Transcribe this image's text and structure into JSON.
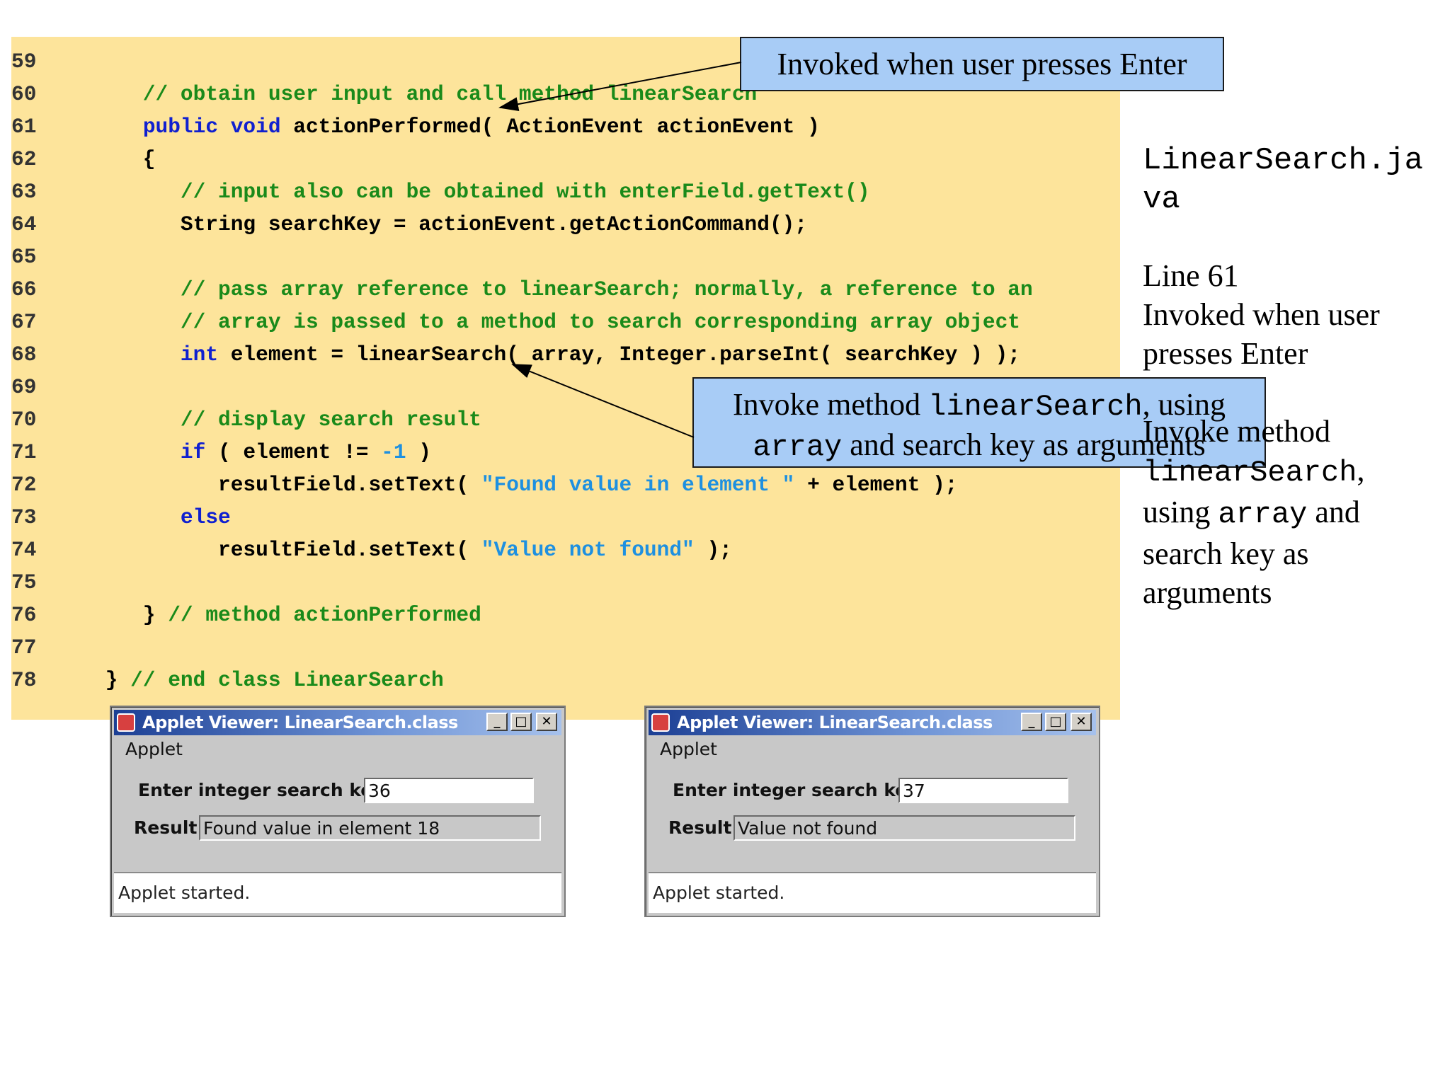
{
  "code": {
    "lines": [
      {
        "num": "59",
        "tokens": []
      },
      {
        "num": "60",
        "tokens": [
          {
            "t": "    // obtain user input and call method linearSearch",
            "c": "cm"
          }
        ]
      },
      {
        "num": "61",
        "tokens": [
          {
            "t": "    ",
            "c": "tx"
          },
          {
            "t": "public",
            "c": "kw"
          },
          {
            "t": " ",
            "c": "tx"
          },
          {
            "t": "void",
            "c": "kw"
          },
          {
            "t": " actionPerformed( ActionEvent actionEvent )",
            "c": "tx"
          }
        ]
      },
      {
        "num": "62",
        "tokens": [
          {
            "t": "    {",
            "c": "tx"
          }
        ]
      },
      {
        "num": "63",
        "tokens": [
          {
            "t": "       // input also can be obtained with enterField.getText()",
            "c": "cm"
          }
        ]
      },
      {
        "num": "64",
        "tokens": [
          {
            "t": "       String searchKey = actionEvent.getActionCommand();",
            "c": "tx"
          }
        ]
      },
      {
        "num": "65",
        "tokens": []
      },
      {
        "num": "66",
        "tokens": [
          {
            "t": "       // pass array reference to linearSearch; normally, a reference to an",
            "c": "cm"
          }
        ]
      },
      {
        "num": "67",
        "tokens": [
          {
            "t": "       // array is passed to a method to search corresponding array object",
            "c": "cm"
          }
        ]
      },
      {
        "num": "68",
        "tokens": [
          {
            "t": "       ",
            "c": "tx"
          },
          {
            "t": "int",
            "c": "kw"
          },
          {
            "t": " element = linearSearch( array, Integer.parseInt( searchKey ) );",
            "c": "tx"
          }
        ]
      },
      {
        "num": "69",
        "tokens": []
      },
      {
        "num": "70",
        "tokens": [
          {
            "t": "       // display search result",
            "c": "cm"
          }
        ]
      },
      {
        "num": "71",
        "tokens": [
          {
            "t": "       ",
            "c": "tx"
          },
          {
            "t": "if",
            "c": "kw"
          },
          {
            "t": " ( element != ",
            "c": "tx"
          },
          {
            "t": "-1",
            "c": "nm"
          },
          {
            "t": " )",
            "c": "tx"
          }
        ]
      },
      {
        "num": "72",
        "tokens": [
          {
            "t": "          resultField.setText( ",
            "c": "tx"
          },
          {
            "t": "\"Found value in element \"",
            "c": "st"
          },
          {
            "t": " + element );",
            "c": "tx"
          }
        ]
      },
      {
        "num": "73",
        "tokens": [
          {
            "t": "       ",
            "c": "tx"
          },
          {
            "t": "else",
            "c": "kw"
          }
        ]
      },
      {
        "num": "74",
        "tokens": [
          {
            "t": "          resultField.setText( ",
            "c": "tx"
          },
          {
            "t": "\"Value not found\"",
            "c": "st"
          },
          {
            "t": " );",
            "c": "tx"
          }
        ]
      },
      {
        "num": "75",
        "tokens": []
      },
      {
        "num": "76",
        "tokens": [
          {
            "t": "    } ",
            "c": "tx"
          },
          {
            "t": "// method actionPerformed",
            "c": "cm"
          }
        ]
      },
      {
        "num": "77",
        "tokens": []
      },
      {
        "num": "78",
        "tokens": [
          {
            "t": " } ",
            "c": "tx"
          },
          {
            "t": "// end class LinearSearch",
            "c": "cm"
          }
        ]
      }
    ]
  },
  "callouts": {
    "enter": "Invoked when user presses Enter",
    "invoke": {
      "part1": "Invoke method ",
      "method": "linearSearch",
      "part2": ", using",
      "arg": "array",
      "part3": " and search key as arguments"
    }
  },
  "side_notes": {
    "file": "LinearSearch.java",
    "line_label": "Line 61",
    "line_desc": "Invoked when user presses Enter",
    "invoke": {
      "part1": "Invoke method",
      "method": "linearSearch",
      "part2": ",",
      "part3": "using",
      "arg": "array",
      "part4": "and",
      "part5": "search key as arguments"
    }
  },
  "applets": [
    {
      "title": "Applet Viewer: LinearSearch.class",
      "menu": "Applet",
      "key_label": "Enter integer search key",
      "key_value": "36",
      "result_label": "Result",
      "result_value": "Found value in element 18",
      "status": "Applet started."
    },
    {
      "title": "Applet Viewer: LinearSearch.class",
      "menu": "Applet",
      "key_label": "Enter integer search key",
      "key_value": "37",
      "result_label": "Result",
      "result_value": "Value not found",
      "status": "Applet started."
    }
  ],
  "window_buttons": {
    "minimize": "_",
    "maximize": "□",
    "close": "✕"
  },
  "colors": {
    "code_background": "#fde49b",
    "keyword": "#1020d0",
    "comment": "#1a8a1a",
    "string_literal": "#1e90e0",
    "callout_background": "#a8ccf6"
  }
}
